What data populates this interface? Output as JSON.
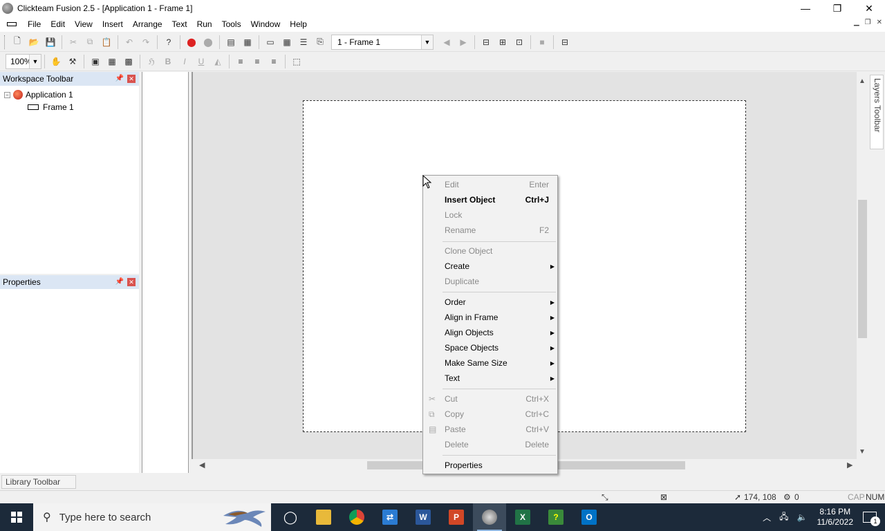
{
  "window": {
    "title": "Clickteam Fusion 2.5 - [Application 1 - Frame 1]",
    "minimize": "—",
    "restore": "❐",
    "close": "✕"
  },
  "menu": {
    "items": [
      "File",
      "Edit",
      "View",
      "Insert",
      "Arrange",
      "Text",
      "Run",
      "Tools",
      "Window",
      "Help"
    ]
  },
  "toolbar": {
    "frame_selector": "1 - Frame 1",
    "zoom": "100%"
  },
  "workspace": {
    "title": "Workspace Toolbar",
    "tree": {
      "application": "Application 1",
      "frame": "Frame 1"
    }
  },
  "properties": {
    "title": "Properties"
  },
  "layers_tab": "Layers Toolbar",
  "library_tab": "Library Toolbar",
  "status": {
    "coords": "174, 108",
    "objects": "0",
    "caps": "CAP",
    "num": "NUM"
  },
  "context_menu": {
    "items": [
      {
        "label": "Edit",
        "shortcut": "Enter",
        "disabled": true
      },
      {
        "label": "Insert Object",
        "shortcut": "Ctrl+J",
        "bold": true
      },
      {
        "label": "Lock",
        "shortcut": "",
        "disabled": true
      },
      {
        "label": "Rename",
        "shortcut": "F2",
        "disabled": true
      },
      {
        "label": "Clone Object",
        "shortcut": "",
        "disabled": true
      },
      {
        "label": "Create",
        "submenu": true
      },
      {
        "label": "Duplicate",
        "disabled": true
      },
      {
        "label": "Order",
        "submenu": true
      },
      {
        "label": "Align in Frame",
        "submenu": true
      },
      {
        "label": "Align Objects",
        "submenu": true
      },
      {
        "label": "Space Objects",
        "submenu": true
      },
      {
        "label": "Make Same Size",
        "submenu": true
      },
      {
        "label": "Text",
        "submenu": true
      },
      {
        "label": "Cut",
        "shortcut": "Ctrl+X",
        "disabled": true
      },
      {
        "label": "Copy",
        "shortcut": "Ctrl+C",
        "disabled": true
      },
      {
        "label": "Paste",
        "shortcut": "Ctrl+V",
        "disabled": true
      },
      {
        "label": "Delete",
        "shortcut": "Delete",
        "disabled": true
      },
      {
        "label": "Properties"
      }
    ]
  },
  "taskbar": {
    "search_placeholder": "Type here to search",
    "time": "8:16 PM",
    "date": "11/6/2022",
    "notification_count": "1"
  },
  "colors": {
    "taskbar_bg": "#1c2a3a",
    "panel_header": "#dbe6f4",
    "editor_bg": "#e3e3e3",
    "close_red": "#d9534f"
  }
}
